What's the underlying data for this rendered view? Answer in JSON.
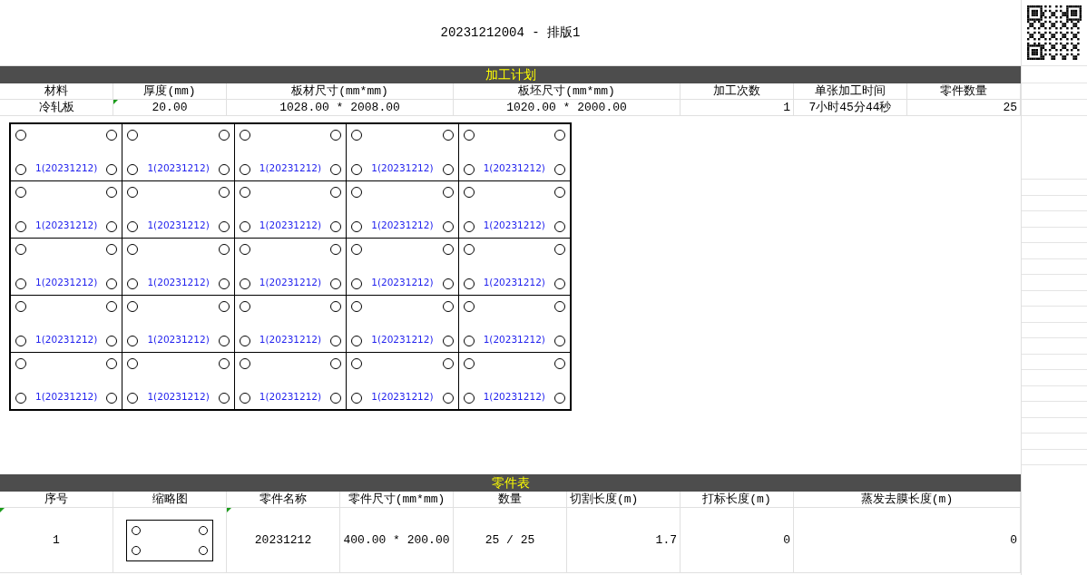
{
  "title": "20231212004 - 排版1",
  "plan": {
    "title": "加工计划",
    "columns": [
      "材料",
      "厚度(mm)",
      "板材尺寸(mm*mm)",
      "板坯尺寸(mm*mm)",
      "加工次数",
      "单张加工时间",
      "零件数量"
    ],
    "row": [
      "冷轧板",
      "20.00",
      "1028.00 * 2008.00",
      "1020.00 * 2000.00",
      "1",
      "7小时45分44秒",
      "25"
    ]
  },
  "nesting": {
    "parts": [
      "1(20231212)",
      "1(20231212)",
      "1(20231212)",
      "1(20231212)",
      "1(20231212)",
      "1(20231212)",
      "1(20231212)",
      "1(20231212)",
      "1(20231212)",
      "1(20231212)",
      "1(20231212)",
      "1(20231212)",
      "1(20231212)",
      "1(20231212)",
      "1(20231212)",
      "1(20231212)",
      "1(20231212)",
      "1(20231212)",
      "1(20231212)",
      "1(20231212)",
      "1(20231212)",
      "1(20231212)",
      "1(20231212)",
      "1(20231212)",
      "1(20231212)"
    ]
  },
  "parts_table": {
    "title": "零件表",
    "columns": [
      "序号",
      "缩略图",
      "零件名称",
      "零件尺寸(mm*mm)",
      "数量",
      "切割长度(m)",
      "打标长度(m)",
      "蒸发去膜长度(m)"
    ],
    "rows": [
      {
        "index": "1",
        "name": "20231212",
        "size": "400.00 * 200.00",
        "quantity": "25 / 25",
        "cut_length": "1.7",
        "mark_length": "0",
        "film_length": "0"
      }
    ]
  }
}
